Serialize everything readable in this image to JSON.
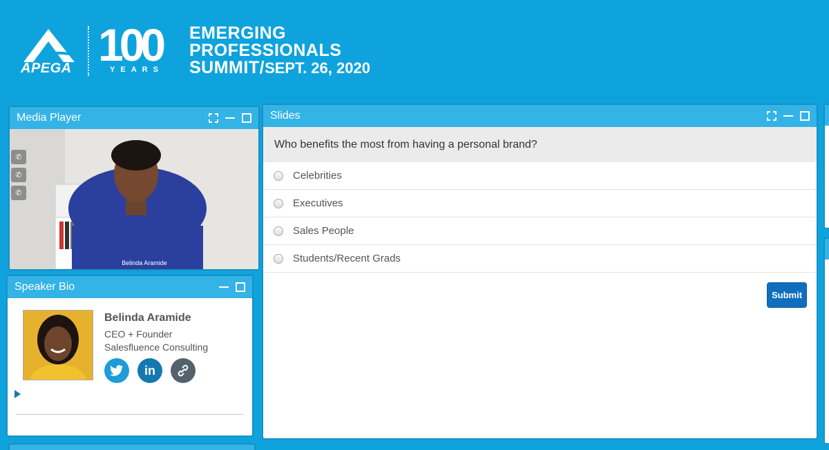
{
  "header": {
    "org": "APEGA",
    "anniversary_number": "100",
    "anniversary_unit": "YEARS",
    "event_line1": "EMERGING",
    "event_line2": "PROFESSIONALS",
    "event_line3": "SUMMIT",
    "event_date": "SEPT. 26, 2020"
  },
  "media_player": {
    "title": "Media Player",
    "caption": "Belinda Aramide",
    "side_icons": [
      "phone-icon",
      "phone-icon",
      "phone-icon"
    ]
  },
  "speaker_bio": {
    "title": "Speaker Bio",
    "name": "Belinda Aramide",
    "role": "CEO + Founder",
    "company": "Salesfluence Consulting",
    "social": [
      {
        "icon": "twitter-icon",
        "glyph": "🐦"
      },
      {
        "icon": "linkedin-icon",
        "glyph": "in"
      },
      {
        "icon": "link-icon",
        "glyph": "🔗"
      }
    ]
  },
  "slides": {
    "title": "Slides",
    "question": "Who benefits the most from having a personal brand?",
    "options": [
      "Celebrities",
      "Executives",
      "Sales People",
      "Students/Recent Grads"
    ],
    "submit_label": "Submit"
  },
  "colors": {
    "background": "#0fa3dd",
    "panel_header": "#33b3e6",
    "submit": "#0f6fbd"
  }
}
